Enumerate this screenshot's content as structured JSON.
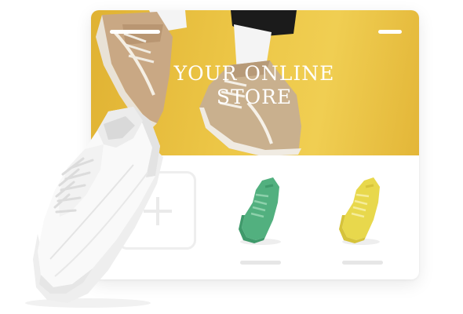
{
  "hero": {
    "title_line1": "YOUR ONLINE",
    "title_line2": "STORE",
    "background_color": "#edc747"
  },
  "products": [
    {
      "color": "#52b07f"
    },
    {
      "color": "#e8d84c"
    }
  ],
  "icons": {
    "menu": "hamburger-icon",
    "add": "plus-icon"
  }
}
